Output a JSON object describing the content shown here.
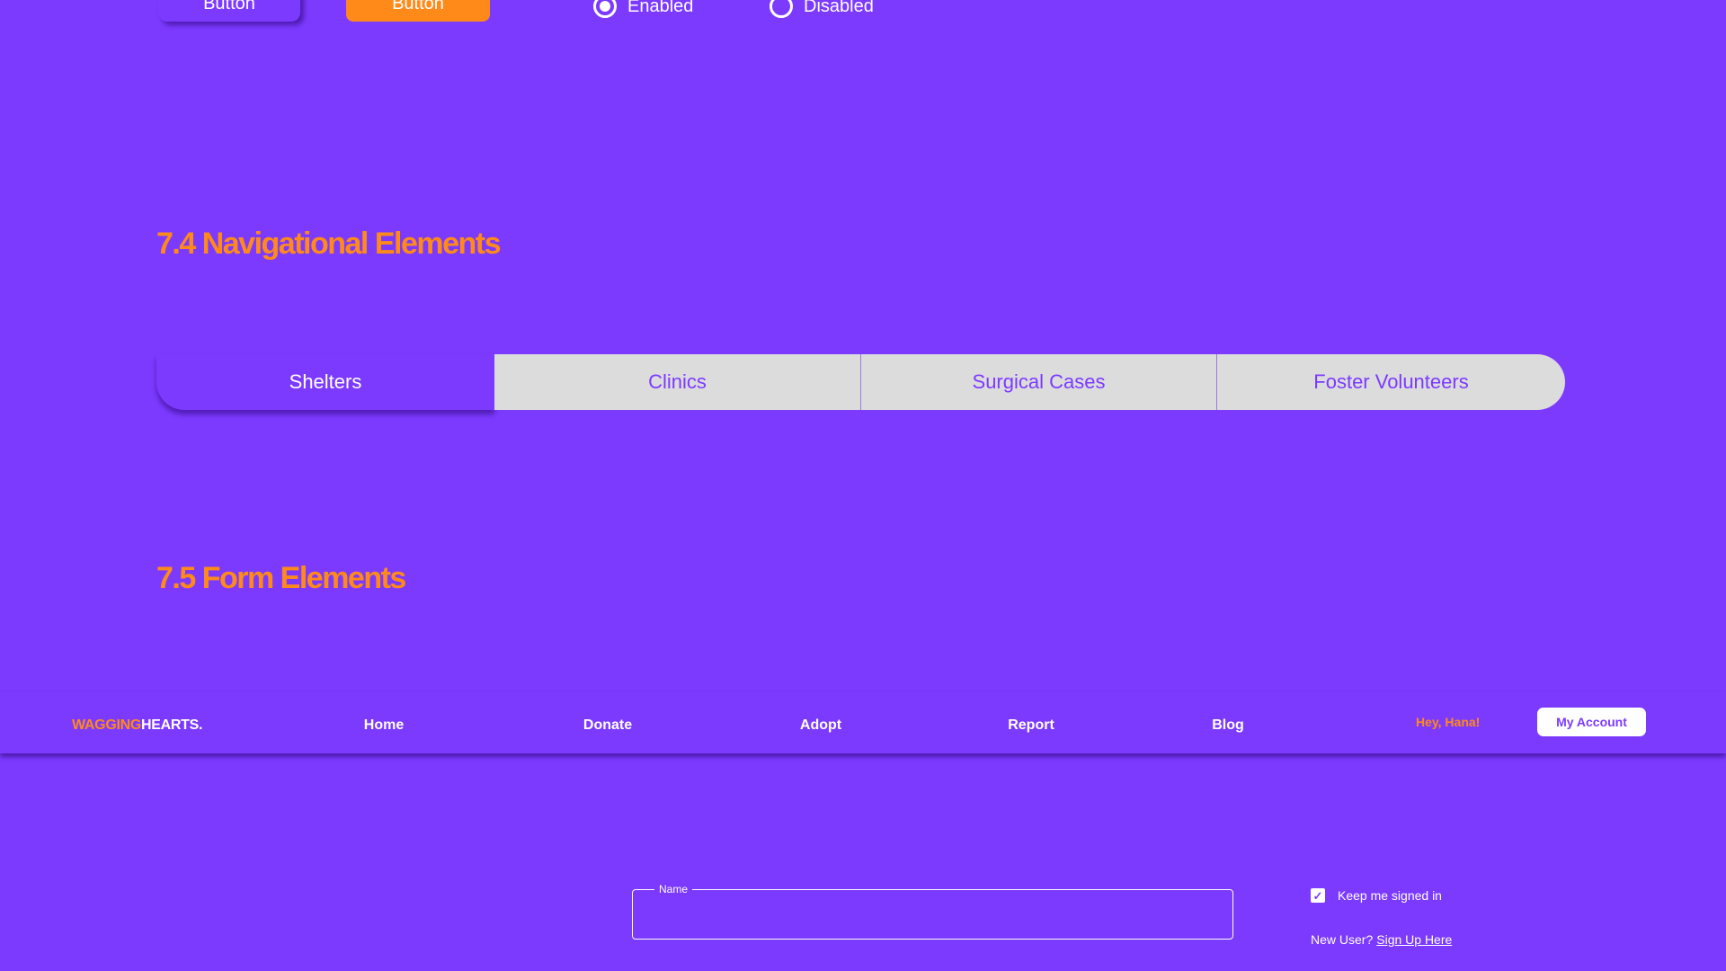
{
  "top_row": {
    "outline_button_label": "Button",
    "filled_button_label": "Button",
    "radio_enabled_label": "Enabled",
    "radio_disabled_label": "Disabled"
  },
  "sections": {
    "nav_title": "7.4 Navigational Elements",
    "form_title": "7.5 Form Elements"
  },
  "tabs": [
    {
      "label": "Shelters",
      "active": true
    },
    {
      "label": "Clinics",
      "active": false
    },
    {
      "label": "Surgical Cases",
      "active": false
    },
    {
      "label": "Foster Volunteers",
      "active": false
    }
  ],
  "navbar": {
    "brand_part1": "WAGGING",
    "brand_part2": "HEARTS.",
    "links": [
      "Home",
      "Donate",
      "Adopt",
      "Report",
      "Blog"
    ],
    "greeting": "Hey, Hana!",
    "account_button": "My Account"
  },
  "form": {
    "name_label": "Name",
    "name_value": "",
    "keep_signed_in_label": "Keep me signed in",
    "keep_signed_in_checked": true,
    "new_user_text": "New User?",
    "signup_link": "Sign Up Here"
  },
  "colors": {
    "background": "#7c3aff",
    "accent": "#ff8a1a",
    "tab_inactive": "#dcdcdc",
    "white": "#ffffff"
  }
}
